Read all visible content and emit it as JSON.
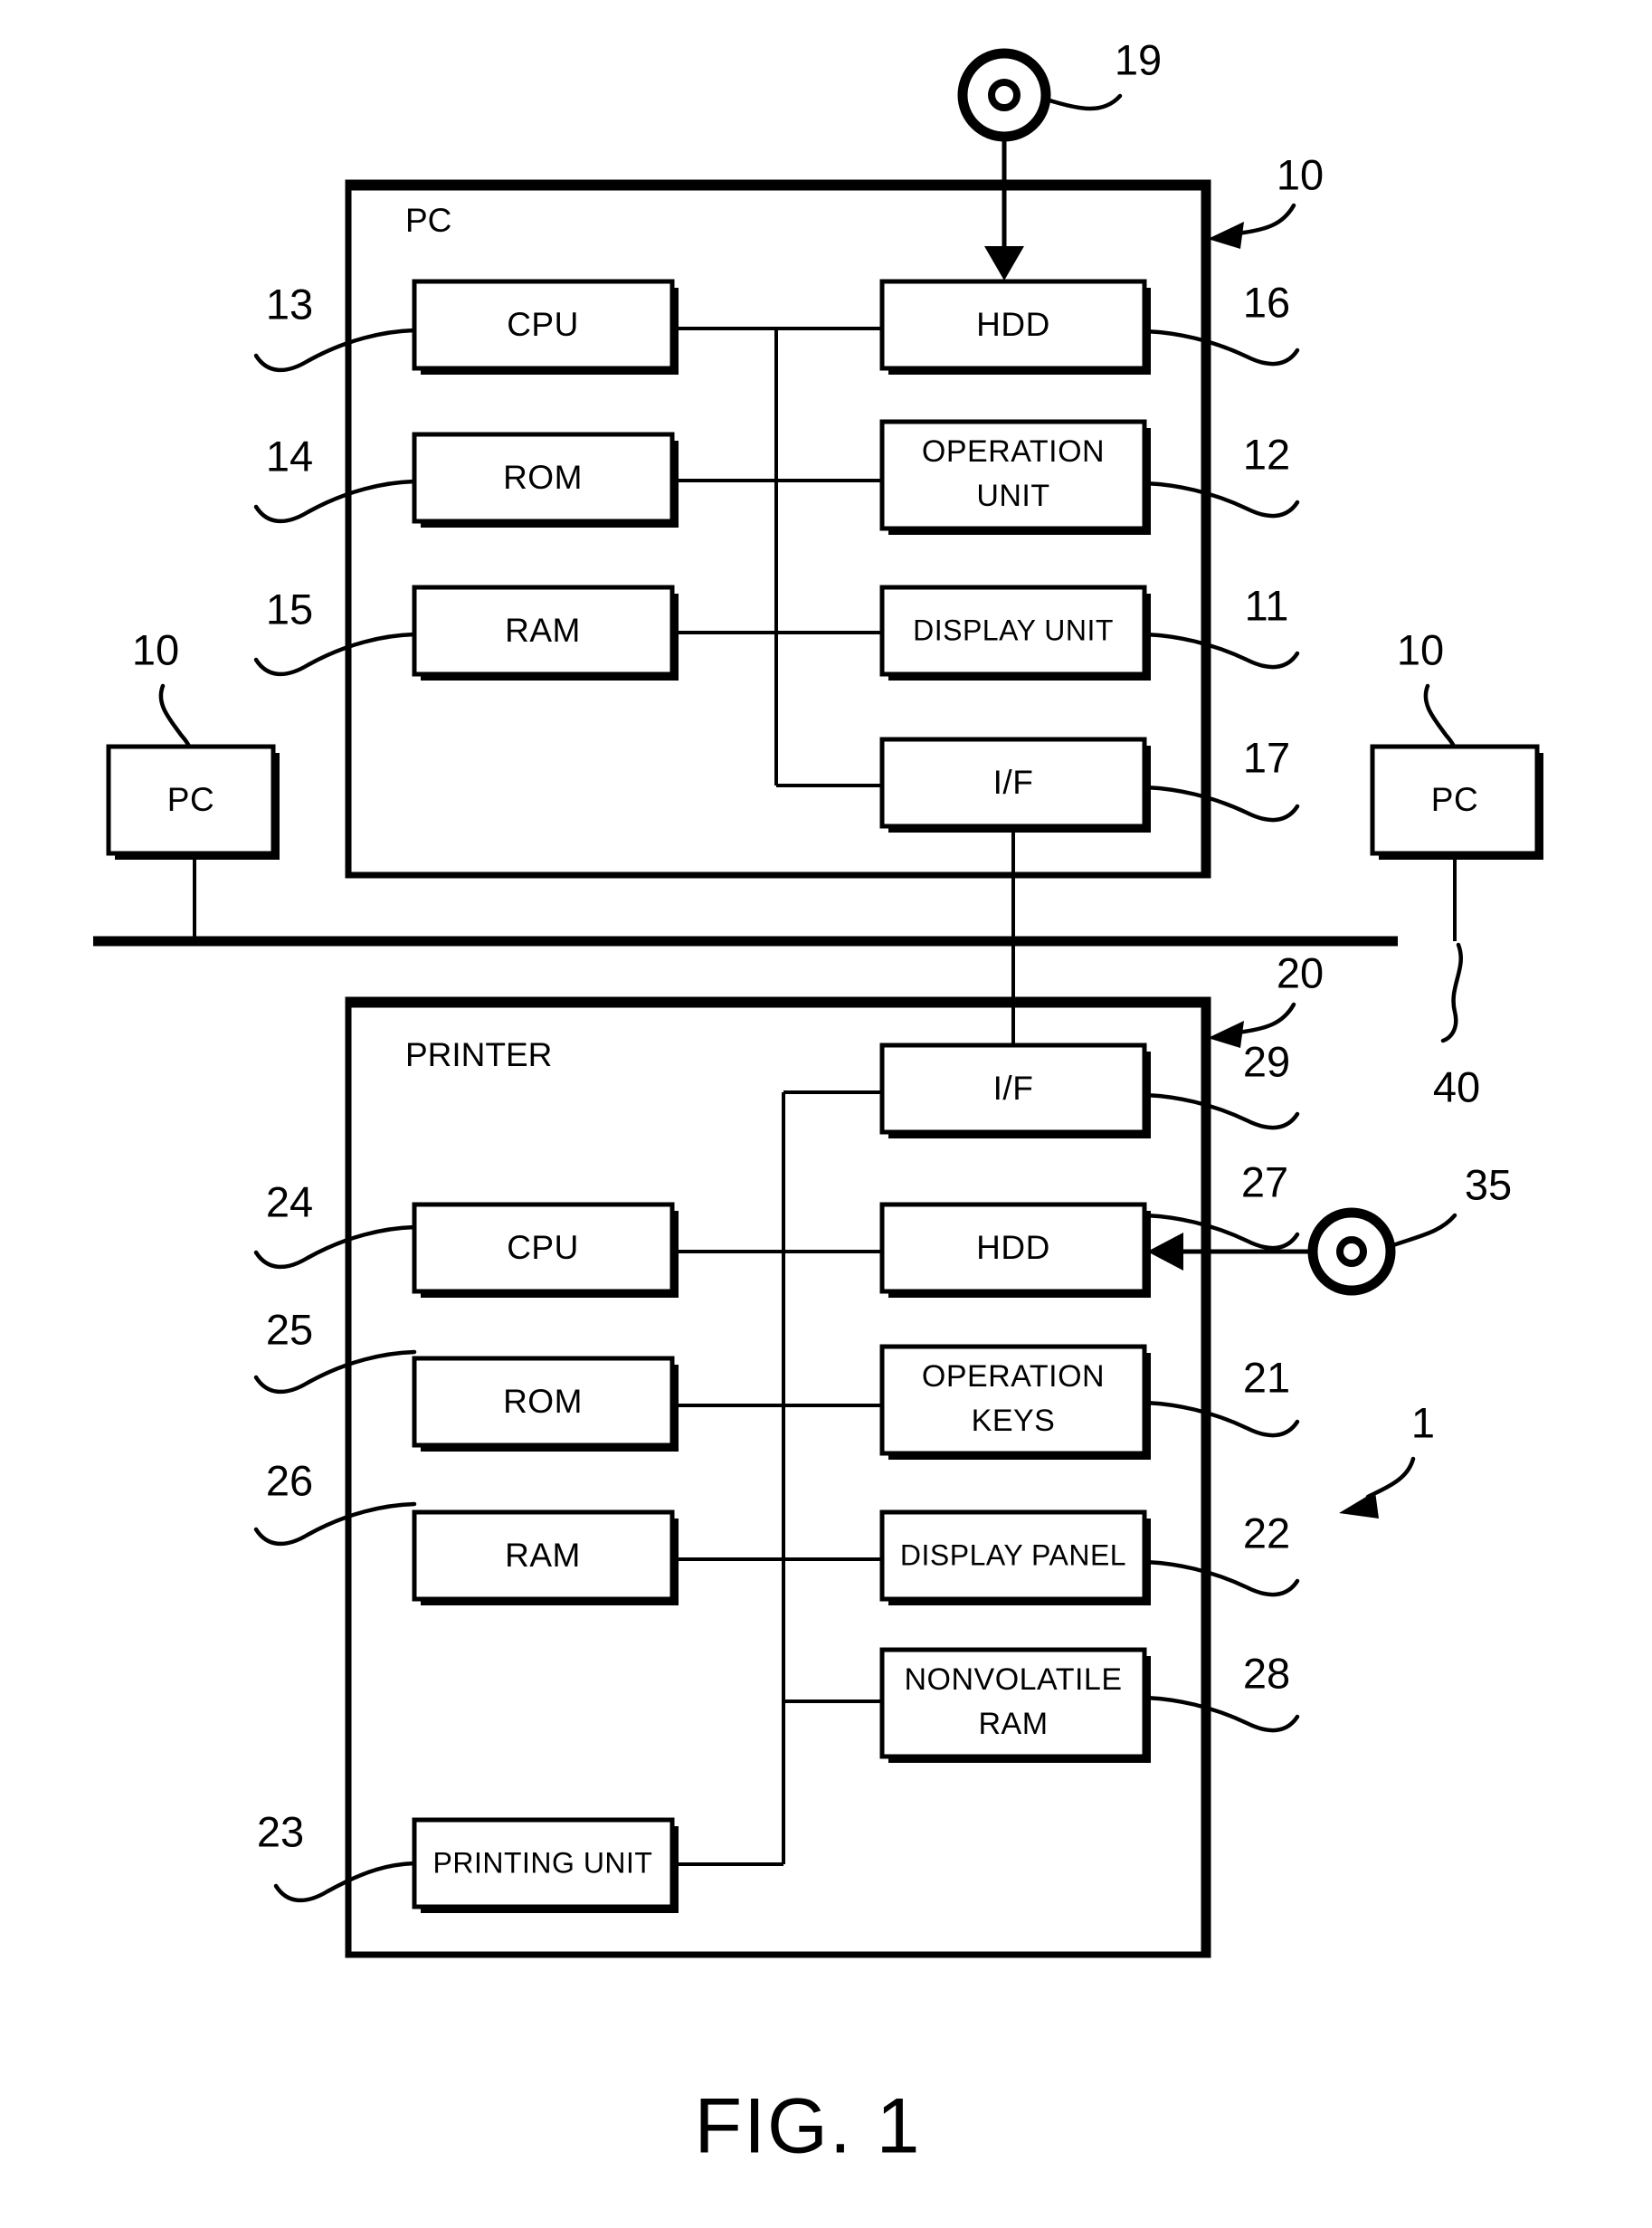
{
  "figure": {
    "caption": "FIG. 1",
    "system_ref": "1"
  },
  "pc_system": {
    "title": "PC",
    "ref": "10",
    "blocks": [
      {
        "label": "CPU",
        "ref": "13",
        "ref_side": "left"
      },
      {
        "label": "ROM",
        "ref": "14",
        "ref_side": "left"
      },
      {
        "label": "RAM",
        "ref": "15",
        "ref_side": "left"
      },
      {
        "label": "HDD",
        "ref": "16",
        "ref_side": "right"
      },
      {
        "label": "OPERATION UNIT",
        "ref": "12",
        "ref_side": "right",
        "line1": "OPERATION",
        "line2": "UNIT"
      },
      {
        "label": "DISPLAY UNIT",
        "ref": "11",
        "ref_side": "right"
      },
      {
        "label": "I/F",
        "ref": "17",
        "ref_side": "right"
      }
    ],
    "media": {
      "ref": "19",
      "icon": "disk-media-icon"
    }
  },
  "printer_system": {
    "title": "PRINTER",
    "ref": "20",
    "blocks": [
      {
        "label": "CPU",
        "ref": "24",
        "ref_side": "left"
      },
      {
        "label": "ROM",
        "ref": "25",
        "ref_side": "left"
      },
      {
        "label": "RAM",
        "ref": "26",
        "ref_side": "left"
      },
      {
        "label": "PRINTING UNIT",
        "ref": "23",
        "ref_side": "left"
      },
      {
        "label": "I/F",
        "ref": "29",
        "ref_side": "right"
      },
      {
        "label": "HDD",
        "ref": "27",
        "ref_side": "right"
      },
      {
        "label": "OPERATION KEYS",
        "ref": "21",
        "ref_side": "right",
        "line1": "OPERATION",
        "line2": "KEYS"
      },
      {
        "label": "DISPLAY PANEL",
        "ref": "22",
        "ref_side": "right"
      },
      {
        "label": "NONVOLATILE RAM",
        "ref": "28",
        "ref_side": "right",
        "line1": "NONVOLATILE",
        "line2": "RAM"
      }
    ],
    "media": {
      "ref": "35",
      "icon": "disk-media-icon"
    }
  },
  "network": {
    "ref": "40",
    "nodes": [
      {
        "label": "PC",
        "ref": "10",
        "position": "left"
      },
      {
        "label": "PC",
        "ref": "10",
        "position": "right"
      }
    ]
  },
  "colors": {
    "ink": "#000000",
    "paper": "#ffffff"
  }
}
